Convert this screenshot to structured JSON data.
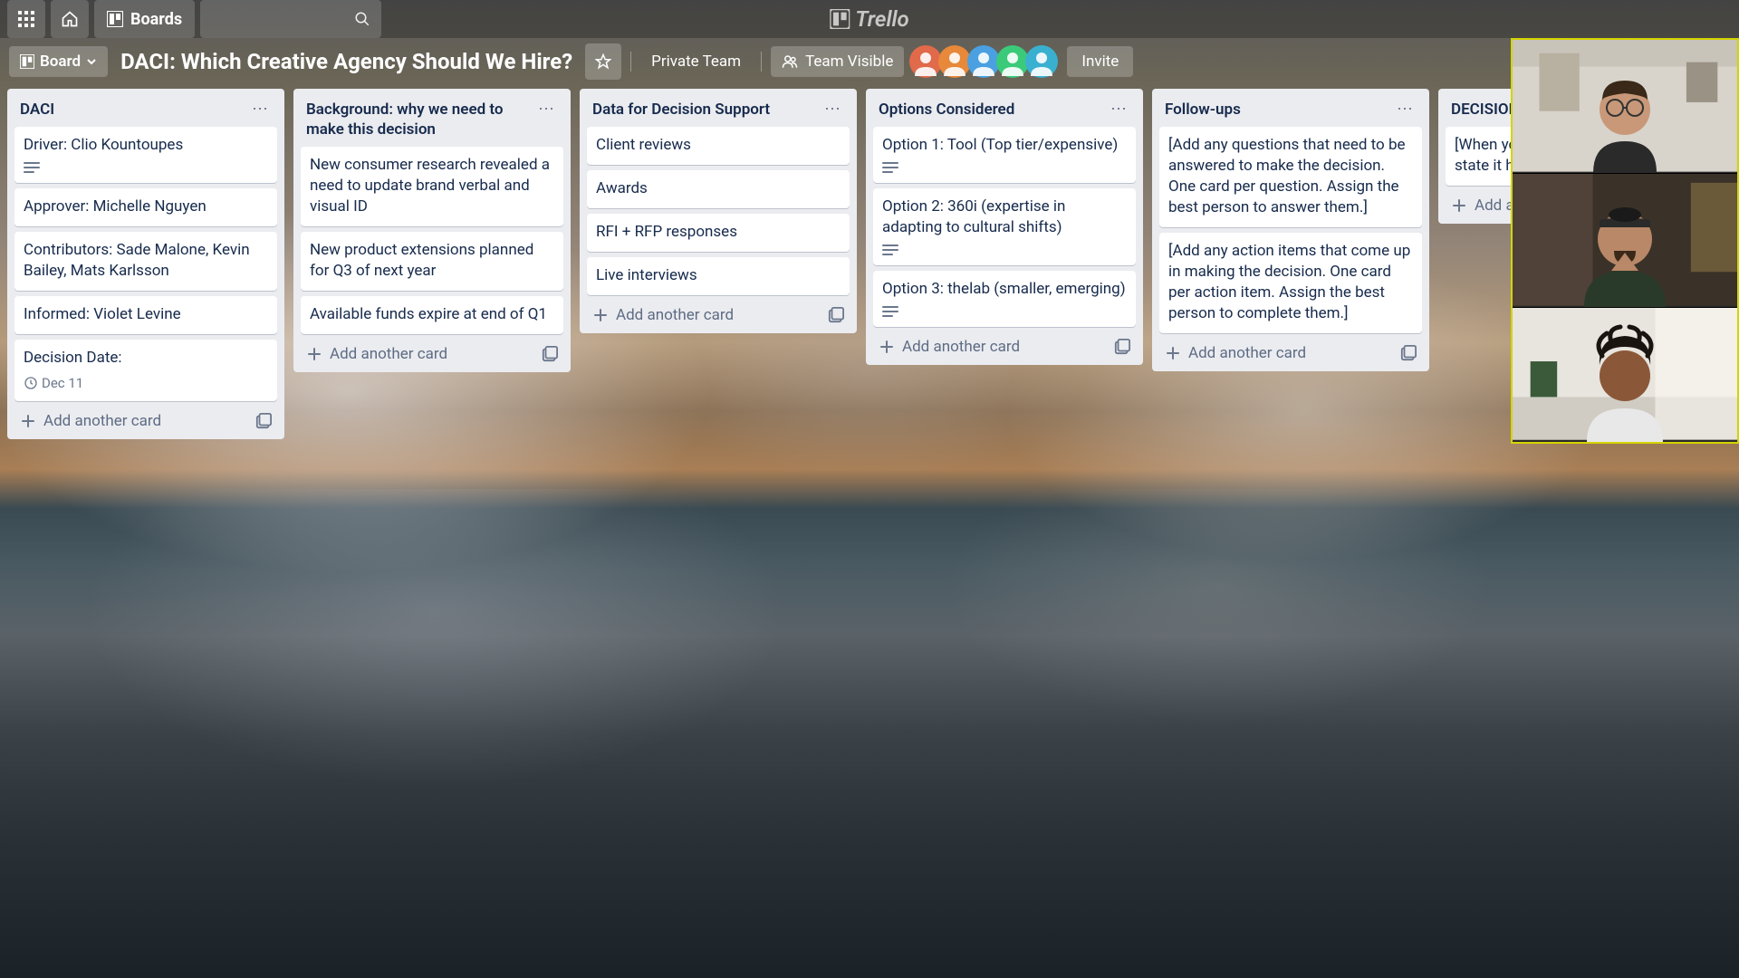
{
  "app_name": "Trello",
  "topbar": {
    "boards_label": "Boards",
    "search_placeholder": ""
  },
  "board": {
    "view_button": "Board",
    "title": "DACI: Which Creative Agency Should We Hire?",
    "privacy_label": "Private Team",
    "visibility_label": "Team Visible",
    "invite_label": "Invite",
    "avatar_colors": [
      "#e06a4a",
      "#e7883a",
      "#4aa0e0",
      "#3aca7a",
      "#3ab0d0"
    ]
  },
  "add_card_label": "Add another card",
  "lists": [
    {
      "title": "DACI",
      "cards": [
        {
          "text": "Driver: Clio Kountoupes",
          "desc": true
        },
        {
          "text": "Approver: Michelle Nguyen"
        },
        {
          "text": "Contributors: Sade Malone, Kevin Bailey, Mats Karlsson"
        },
        {
          "text": "Informed: Violet Levine"
        },
        {
          "text": "Decision Date:",
          "due": "Dec 11"
        }
      ]
    },
    {
      "title": "Background: why we need to make this decision",
      "cards": [
        {
          "text": "New consumer research revealed a need to update brand verbal and visual ID"
        },
        {
          "text": "New product extensions planned for Q3 of next year"
        },
        {
          "text": "Available funds expire at end of Q1"
        }
      ]
    },
    {
      "title": "Data for Decision Support",
      "cards": [
        {
          "text": "Client reviews"
        },
        {
          "text": "Awards"
        },
        {
          "text": "RFI + RFP responses"
        },
        {
          "text": "Live interviews"
        }
      ]
    },
    {
      "title": "Options Considered",
      "cards": [
        {
          "text": "Option 1: Tool (Top tier/expensive)",
          "desc": true
        },
        {
          "text": "Option 2: 360i (expertise in adapting to cultural shifts)",
          "desc": true
        },
        {
          "text": "Option 3: thelab (smaller, emerging)",
          "desc": true
        }
      ]
    },
    {
      "title": "Follow-ups",
      "cards": [
        {
          "text": "[Add any questions that need to be answered to make the decision. One card per question. Assign the best person to answer them.]"
        },
        {
          "text": "[Add any action items that come up in making the decision. One card per action item. Assign the best person to complete them.]"
        }
      ]
    },
    {
      "title": "DECISION",
      "cards": [
        {
          "text": "[When you've made a decision, state it here.]"
        }
      ]
    }
  ]
}
